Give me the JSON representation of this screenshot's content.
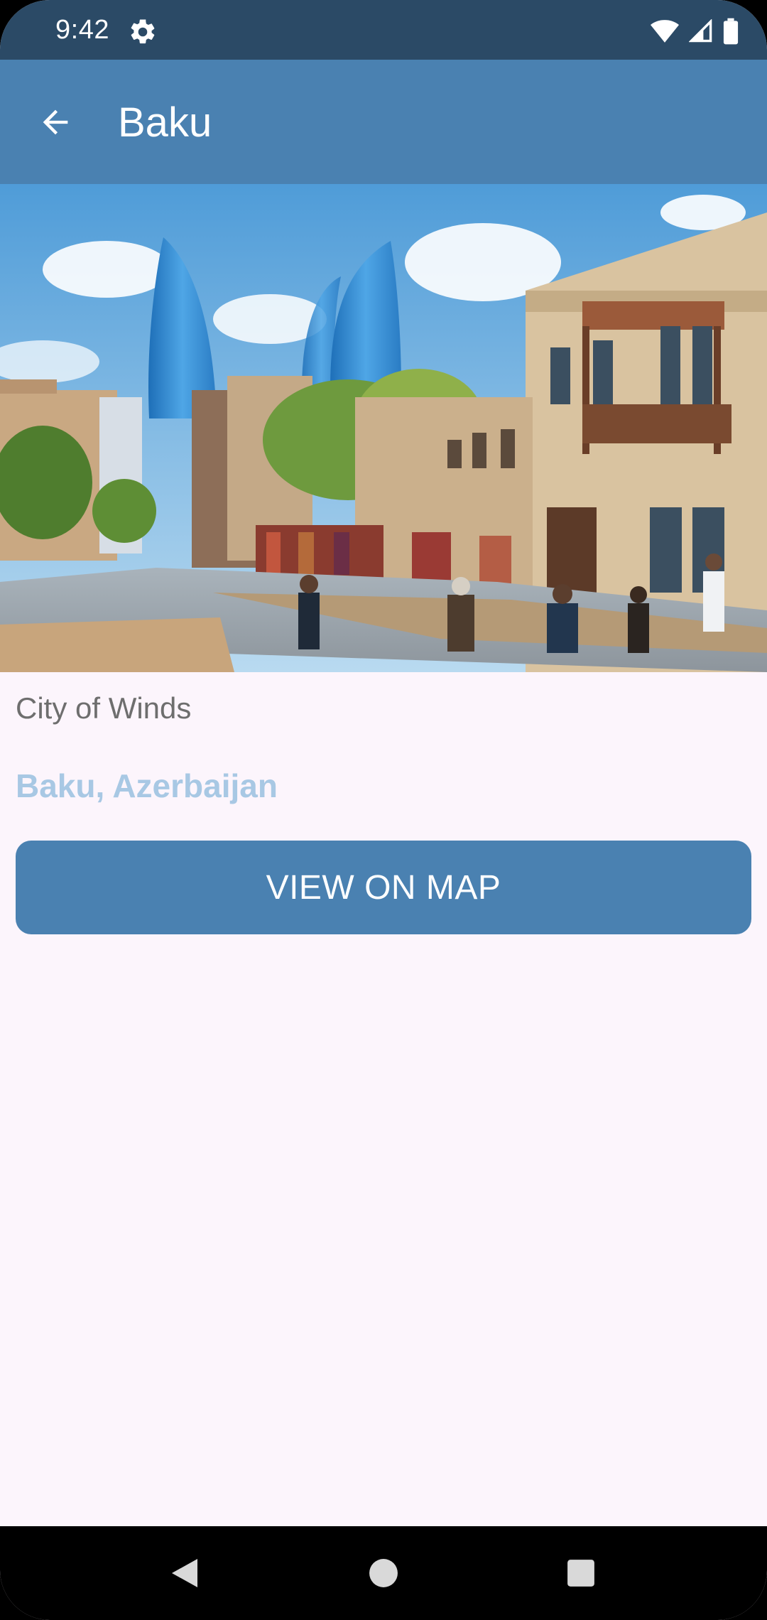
{
  "status_bar": {
    "time": "9:42",
    "icons": [
      "settings-gear-icon",
      "wifi-icon",
      "cellular-signal-icon",
      "battery-icon"
    ]
  },
  "app_bar": {
    "back_icon": "arrow-back-icon",
    "title": "Baku"
  },
  "hero_image": {
    "subject": "old-city-street-with-flame-towers"
  },
  "content": {
    "subtitle": "City of Winds",
    "location": "Baku, Azerbaijan",
    "map_button_label": "VIEW ON MAP"
  },
  "nav_bar": {
    "icons": [
      "back-triangle-icon",
      "home-circle-icon",
      "recents-square-icon"
    ]
  },
  "colors": {
    "status_bar": "#2B4A66",
    "app_bar": "#4A81B1",
    "button": "#4A81B1",
    "location_text": "#A8C8E4",
    "background": "#FCF5FC"
  }
}
